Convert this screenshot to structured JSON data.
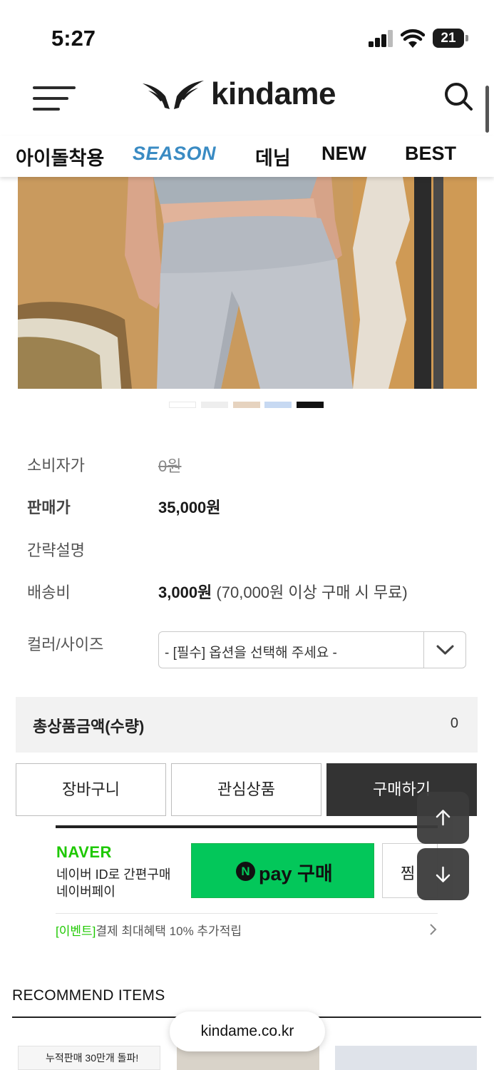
{
  "status_bar": {
    "time": "5:27",
    "battery": "21"
  },
  "header": {
    "logo_text": "kindame"
  },
  "nav": {
    "tabs": [
      "아이돌착용",
      "SEASON",
      "데님",
      "NEW",
      "BEST"
    ]
  },
  "carousel": {
    "swatch_colors": [
      "#ffffff",
      "#eeeeee",
      "#e6d3bf",
      "#c7d9f2",
      "#111111"
    ],
    "active_index": 4
  },
  "product": {
    "consumer_price_label": "소비자가",
    "consumer_price": "0원",
    "sale_price_label": "판매가",
    "sale_price": "35,000원",
    "summary_label": "간략설명",
    "shipping_label": "배송비",
    "shipping_fee": "3,000원",
    "shipping_note": "(70,000원 이상 구매 시 무료)",
    "option_label": "컬러/사이즈",
    "option_placeholder": "- [필수] 옵션을 선택해 주세요 -"
  },
  "total": {
    "label": "총상품금액(수량)",
    "value": "0"
  },
  "buttons": {
    "cart": "장바구니",
    "wishlist": "관심상품",
    "buy": "구매하기"
  },
  "naver_pay": {
    "logo": "NAVER",
    "desc_line1": "네이버 ID로 간편구매",
    "desc_line2": "네이버페이",
    "pay_button": "pay 구매",
    "zzim": "찜",
    "event_tag": "[이벤트]",
    "event_text": "결제 최대혜택 10% 추가적립"
  },
  "recommend": {
    "title": "RECOMMEND ITEMS",
    "thumb1_text": "누적판매 30만개 돌파!"
  },
  "browser": {
    "url": "kindame.co.kr"
  }
}
